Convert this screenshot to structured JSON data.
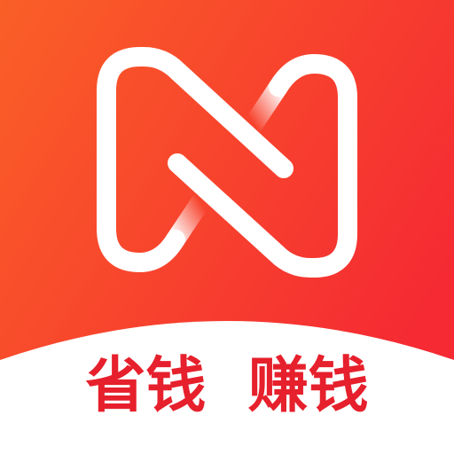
{
  "app_icon": {
    "logo_icon": "n-loop-logo-icon",
    "slogan": "省钱  赚钱"
  },
  "colors": {
    "gradient_start": "#fa5f27",
    "gradient_end": "#f52a33",
    "logo_stroke": "#ffffff",
    "banner_background": "#ffffff",
    "slogan_text": "#e6202c"
  }
}
